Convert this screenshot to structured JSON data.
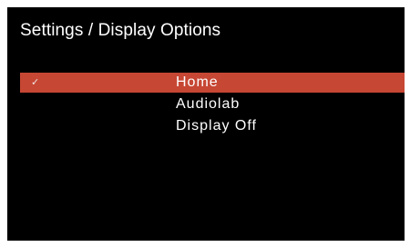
{
  "header": {
    "title": "Settings / Display Options"
  },
  "menu": {
    "items": [
      {
        "label": "Home",
        "selected": true,
        "check": "✓"
      },
      {
        "label": "Audiolab",
        "selected": false,
        "check": ""
      },
      {
        "label": "Display Off",
        "selected": false,
        "check": ""
      }
    ]
  },
  "colors": {
    "background": "#000000",
    "text": "#ffffff",
    "highlight": "#c64734"
  }
}
